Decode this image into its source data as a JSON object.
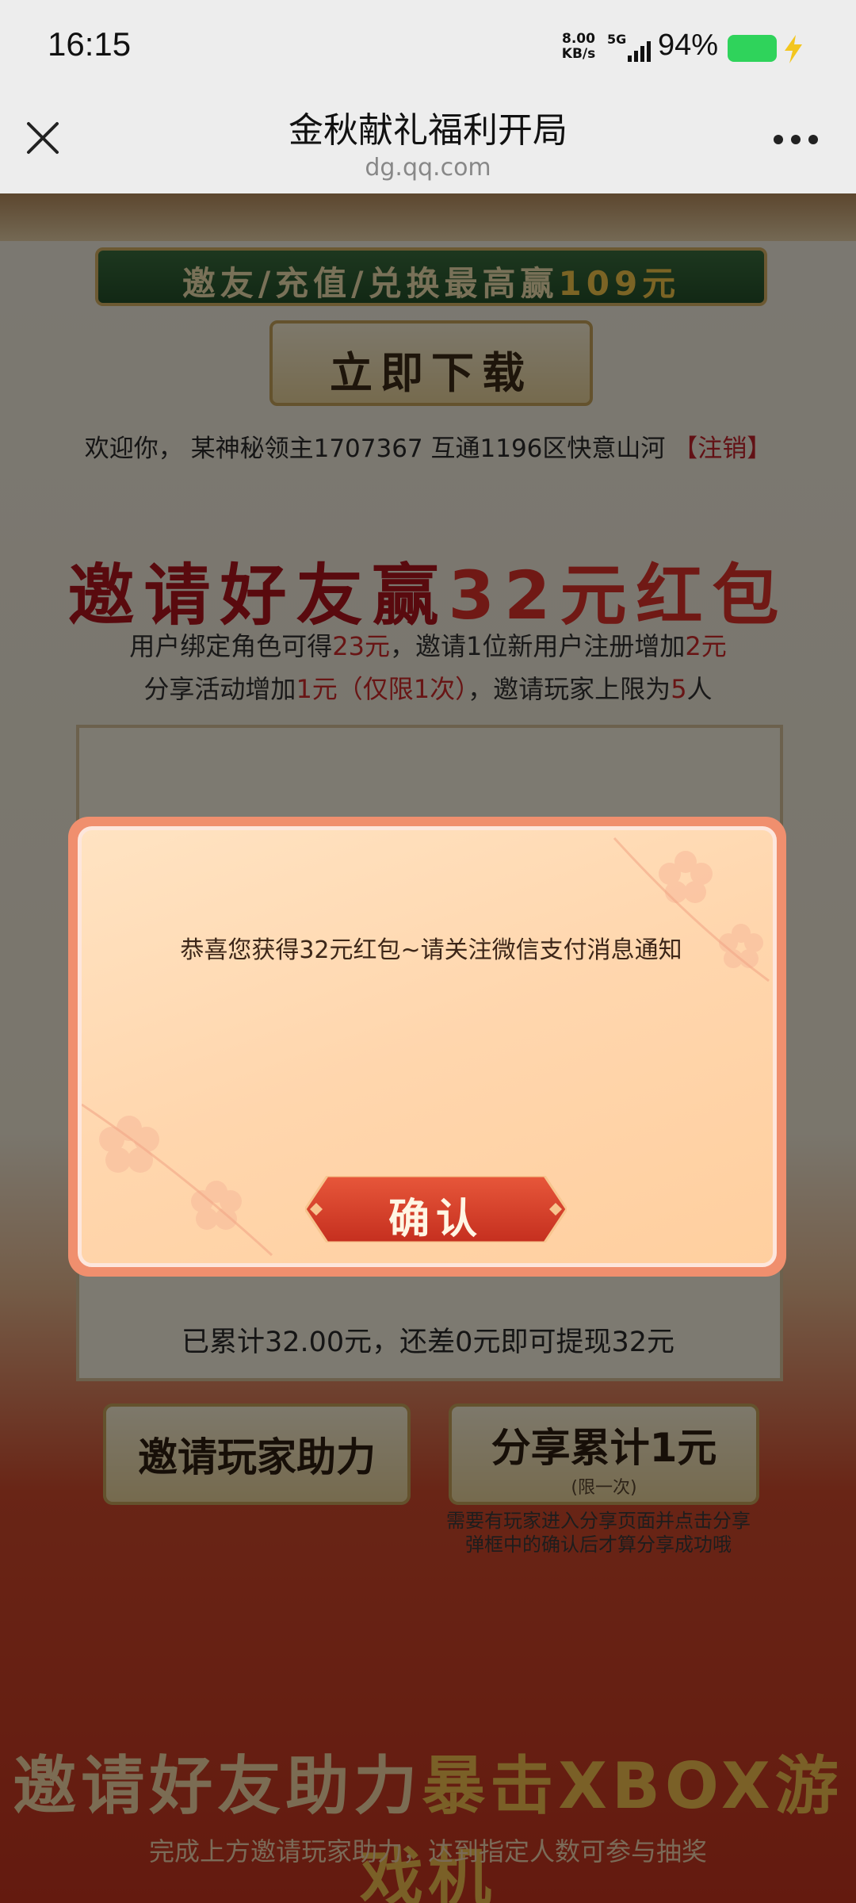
{
  "status_bar": {
    "time": "16:15",
    "net_speed_value": "8.00",
    "net_speed_unit": "KB/s",
    "network": "5G",
    "battery_percent": "94%"
  },
  "title_bar": {
    "title": "金秋献礼福利开局",
    "domain": "dg.qq.com"
  },
  "page": {
    "ribbon_text": "邀友/充值/兑换最高赢",
    "ribbon_amount": "109元",
    "download_label": "立即下载",
    "welcome_prefix": "欢迎你，",
    "welcome_user": "某神秘领主1707367 互通1196区快意山河",
    "welcome_logout": "【注销】",
    "section1": {
      "title_a": "邀请好友赢",
      "title_b": "32元红包",
      "desc_line1_a": "用户绑定角色可得",
      "desc_line1_b": "23元",
      "desc_line1_c": "，邀请1位新用户注册增加",
      "desc_line1_d": "2元",
      "desc_line2_a": "分享活动增加",
      "desc_line2_b": "1元（仅限1次）",
      "desc_line2_c": "，邀请玩家上限为",
      "desc_line2_d": "5",
      "desc_line2_e": "人"
    },
    "accumulated_text": "已累计32.00元，还差0元即可提现32元",
    "invite_help_button": "邀请玩家助力",
    "share_button": "分享累计1元",
    "share_button_sub": "(限一次)",
    "share_note_line1": "需要有玩家进入分享页面并点击分享",
    "share_note_line2": "弹框中的确认后才算分享成功哦",
    "section2": {
      "title_a": "邀请好友助力",
      "title_b": "暴击XBOX游戏机",
      "desc": "完成上方邀请玩家助力，达到指定人数可参与抽奖"
    }
  },
  "dialog": {
    "message": "恭喜您获得32元红包~请关注微信支付消息通知",
    "confirm_label": "确认"
  },
  "colors": {
    "accent_red": "#c5232b",
    "battery_green": "#2fd35b",
    "dialog_border": "#f08f6e",
    "dialog_bg": "#ffd6ad",
    "confirm_btn": "#d9412b"
  }
}
